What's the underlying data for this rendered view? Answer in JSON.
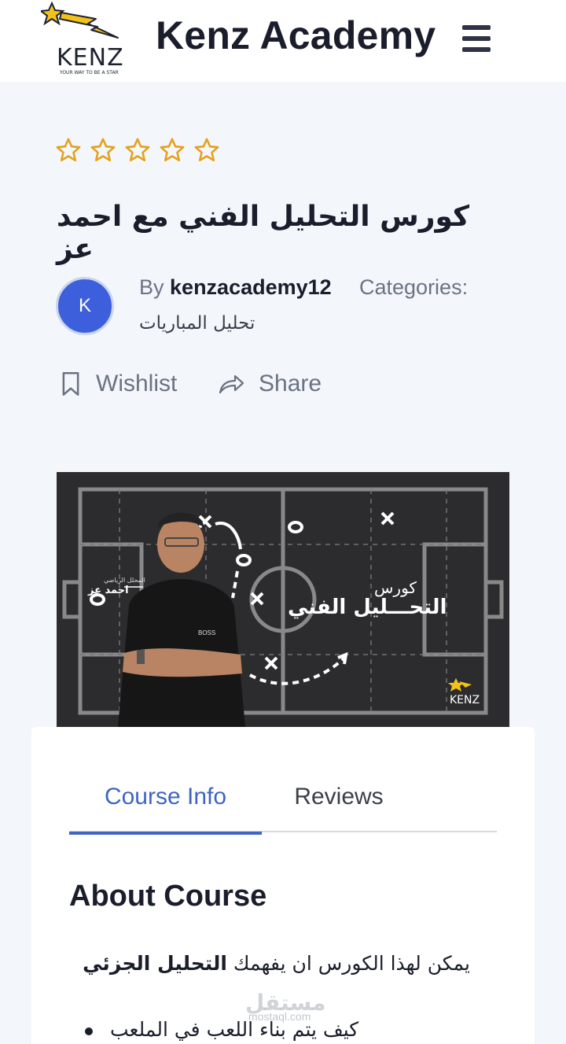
{
  "header": {
    "logo_text": "KENZ",
    "logo_tagline": "YOUR WAY TO BE A STAR",
    "site_title": "Kenz Academy",
    "menu_icon": "hamburger-menu-icon"
  },
  "rating": {
    "stars_filled": 0,
    "stars_total": 5,
    "star_color": "#e6a019"
  },
  "course": {
    "title": "كورس التحليل الفني مع احمد عز",
    "author_initial": "K",
    "by_prefix": "By",
    "author": "kenzacademy12",
    "categories_label": "Categories:",
    "category": "تحليل المباريات"
  },
  "actions": {
    "wishlist_label": "Wishlist",
    "share_label": "Share"
  },
  "thumbnail": {
    "title_small": "كورس",
    "title_big": "التحـــليل الفني",
    "coach_role": "المحلل الرياضي",
    "coach_name": "احمد عز",
    "brand": "KENZ",
    "shirt_text": "BOSS"
  },
  "tabs": [
    {
      "label": "Course Info",
      "active": true
    },
    {
      "label": "Reviews",
      "active": false
    }
  ],
  "about": {
    "heading": "About Course",
    "intro": "يمكن لهذا الكورس ان يفهمك",
    "intro_bold": "التحليل الجزئي",
    "bullets": [
      "كيف يتم بناء اللعب في الملعب"
    ]
  },
  "watermark": {
    "text": "مستقل",
    "sub": "mostaql.com"
  },
  "colors": {
    "accent": "#3f64c2",
    "avatar": "#3e5fdc",
    "background": "#f3f6fb"
  }
}
